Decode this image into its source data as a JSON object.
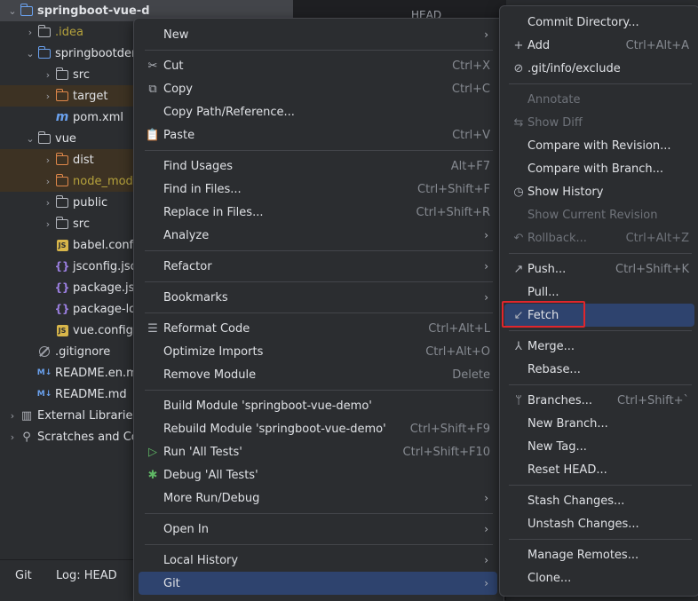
{
  "project_tree": [
    {
      "label": "springboot-vue-d",
      "depth": 0,
      "expanded": true,
      "icon": "module-folder-icon",
      "style": "sel"
    },
    {
      "label": ".idea",
      "depth": 1,
      "expanded": false,
      "icon": "folder-icon",
      "color": "olive"
    },
    {
      "label": "springbootden",
      "depth": 1,
      "expanded": true,
      "icon": "module-folder-icon"
    },
    {
      "label": "src",
      "depth": 2,
      "expanded": false,
      "icon": "folder-icon"
    },
    {
      "label": "target",
      "depth": 2,
      "expanded": false,
      "icon": "folder-icon-orange",
      "style": "excl"
    },
    {
      "label": "pom.xml",
      "depth": 2,
      "leaf": true,
      "icon": "maven-icon"
    },
    {
      "label": "vue",
      "depth": 1,
      "expanded": true,
      "icon": "folder-icon"
    },
    {
      "label": "dist",
      "depth": 2,
      "expanded": false,
      "icon": "folder-icon-orange",
      "style": "excl"
    },
    {
      "label": "node_modu",
      "depth": 2,
      "expanded": false,
      "icon": "folder-icon-orange",
      "style": "excl",
      "color": "olive"
    },
    {
      "label": "public",
      "depth": 2,
      "expanded": false,
      "icon": "folder-icon"
    },
    {
      "label": "src",
      "depth": 2,
      "expanded": false,
      "icon": "folder-icon"
    },
    {
      "label": "babel.confi",
      "depth": 2,
      "leaf": true,
      "icon": "js-icon"
    },
    {
      "label": "jsconfig.jso",
      "depth": 2,
      "leaf": true,
      "icon": "json-icon"
    },
    {
      "label": "package.js",
      "depth": 2,
      "leaf": true,
      "icon": "json-icon"
    },
    {
      "label": "package-lo",
      "depth": 2,
      "leaf": true,
      "icon": "json-icon"
    },
    {
      "label": "vue.config",
      "depth": 2,
      "leaf": true,
      "icon": "js-icon"
    },
    {
      "label": ".gitignore",
      "depth": 1,
      "leaf": true,
      "icon": "gitignore-icon"
    },
    {
      "label": "README.en.m",
      "depth": 1,
      "leaf": true,
      "icon": "markdown-icon"
    },
    {
      "label": "README.md",
      "depth": 1,
      "leaf": true,
      "icon": "markdown-icon"
    },
    {
      "label": "External Libraries",
      "depth": 0,
      "expanded": false,
      "icon": "library-icon"
    },
    {
      "label": "Scratches and Co",
      "depth": 0,
      "expanded": false,
      "icon": "scratches-icon"
    }
  ],
  "bottom_bar": {
    "git_tab": "Git",
    "log_tab": "Log: HEAD"
  },
  "editor": {
    "head_label": "HEAD"
  },
  "context_menu": [
    {
      "label": "New",
      "submenu": true,
      "ul": "N"
    },
    {
      "sep": true
    },
    {
      "label": "Cut",
      "shortcut": "Ctrl+X",
      "icon": "cut-icon",
      "glyph": "✂"
    },
    {
      "label": "Copy",
      "shortcut": "Ctrl+C",
      "icon": "copy-icon",
      "glyph": "⧉"
    },
    {
      "label": "Copy Path/Reference..."
    },
    {
      "label": "Paste",
      "shortcut": "Ctrl+V",
      "icon": "paste-icon",
      "glyph": "📋"
    },
    {
      "sep": true
    },
    {
      "label": "Find Usages",
      "shortcut": "Alt+F7"
    },
    {
      "label": "Find in Files...",
      "shortcut": "Ctrl+Shift+F"
    },
    {
      "label": "Replace in Files...",
      "shortcut": "Ctrl+Shift+R"
    },
    {
      "label": "Analyze",
      "submenu": true
    },
    {
      "sep": true
    },
    {
      "label": "Refactor",
      "submenu": true
    },
    {
      "sep": true
    },
    {
      "label": "Bookmarks",
      "submenu": true
    },
    {
      "sep": true
    },
    {
      "label": "Reformat Code",
      "shortcut": "Ctrl+Alt+L",
      "icon": "reformat-icon",
      "glyph": "☰"
    },
    {
      "label": "Optimize Imports",
      "shortcut": "Ctrl+Alt+O"
    },
    {
      "label": "Remove Module",
      "shortcut": "Delete"
    },
    {
      "sep": true
    },
    {
      "label": "Build Module 'springboot-vue-demo'"
    },
    {
      "label": "Rebuild Module 'springboot-vue-demo'",
      "shortcut": "Ctrl+Shift+F9"
    },
    {
      "label": "Run 'All Tests'",
      "shortcut": "Ctrl+Shift+F10",
      "icon": "run-icon",
      "glyph": "▷",
      "glyph_color": "#5fb865"
    },
    {
      "label": "Debug 'All Tests'",
      "icon": "debug-icon",
      "glyph": "✱",
      "glyph_color": "#5fb865"
    },
    {
      "label": "More Run/Debug",
      "submenu": true
    },
    {
      "sep": true
    },
    {
      "label": "Open In",
      "submenu": true
    },
    {
      "sep": true
    },
    {
      "label": "Local History",
      "submenu": true
    },
    {
      "label": "Git",
      "submenu": true,
      "active": true
    }
  ],
  "git_submenu": [
    {
      "label": "Commit Directory..."
    },
    {
      "label": "Add",
      "shortcut": "Ctrl+Alt+A",
      "icon": "plus-icon",
      "glyph": "+"
    },
    {
      "label": ".git/info/exclude",
      "icon": "exclude-icon",
      "glyph": "⊘"
    },
    {
      "sep": true
    },
    {
      "label": "Annotate",
      "disabled": true
    },
    {
      "label": "Show Diff",
      "disabled": true,
      "icon": "diff-icon",
      "glyph": "⇆"
    },
    {
      "label": "Compare with Revision..."
    },
    {
      "label": "Compare with Branch..."
    },
    {
      "label": "Show History",
      "icon": "history-icon",
      "glyph": "◷"
    },
    {
      "label": "Show Current Revision",
      "disabled": true
    },
    {
      "label": "Rollback...",
      "shortcut": "Ctrl+Alt+Z",
      "disabled": true,
      "icon": "rollback-icon",
      "glyph": "↶"
    },
    {
      "sep": true
    },
    {
      "label": "Push...",
      "shortcut": "Ctrl+Shift+K",
      "icon": "push-icon",
      "glyph": "↗"
    },
    {
      "label": "Pull..."
    },
    {
      "label": "Fetch",
      "active": true,
      "icon": "fetch-icon",
      "glyph": "↙"
    },
    {
      "sep": true
    },
    {
      "label": "Merge...",
      "icon": "merge-icon",
      "glyph": "⅄"
    },
    {
      "label": "Rebase..."
    },
    {
      "sep": true
    },
    {
      "label": "Branches...",
      "shortcut": "Ctrl+Shift+`",
      "icon": "branch-icon",
      "glyph": "ᛘ"
    },
    {
      "label": "New Branch..."
    },
    {
      "label": "New Tag..."
    },
    {
      "label": "Reset HEAD..."
    },
    {
      "sep": true
    },
    {
      "label": "Stash Changes..."
    },
    {
      "label": "Unstash Changes..."
    },
    {
      "sep": true
    },
    {
      "label": "Manage Remotes..."
    },
    {
      "label": "Clone..."
    }
  ]
}
